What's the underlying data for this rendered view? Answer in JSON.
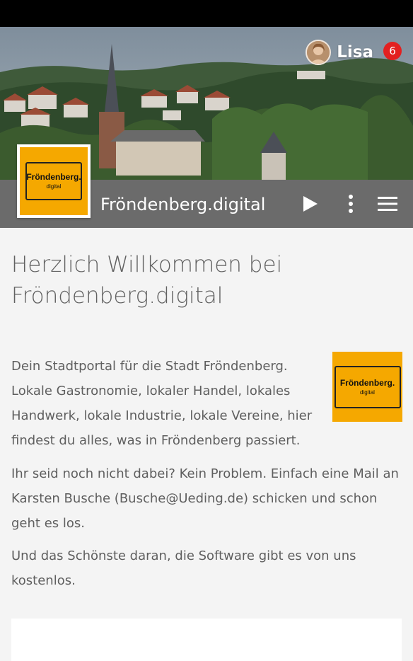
{
  "user": {
    "name": "Lisa",
    "notification_count": "6"
  },
  "app": {
    "title": "Fröndenberg.digital",
    "logo_title": "Fröndenberg.",
    "logo_subtitle": "digital"
  },
  "toolbar": {
    "icons": [
      "play-icon",
      "more-vert-icon",
      "menu-icon"
    ]
  },
  "content": {
    "heading": "Herzlich Willkommen bei Fröndenberg.digital",
    "paragraphs": [
      "Dein Stadtportal für die Stadt Fröndenberg. Lokale Gastronomie, lokaler Handel, lokales Handwerk, lokale Industrie, lokale Vereine, hier findest du alles, was in Fröndenberg passiert.",
      "Ihr seid noch nicht dabei? Kein Problem. Einfach eine Mail an Karsten Busche (Busche@Ueding.de) schicken und schon geht es los.",
      "Und das Schönste daran, die Software gibt es von uns kostenlos."
    ]
  },
  "colors": {
    "toolbar": "#6b6b6b",
    "logo_yellow": "#f5a800",
    "badge_red": "#e32020",
    "text": "#5f5f5f"
  }
}
